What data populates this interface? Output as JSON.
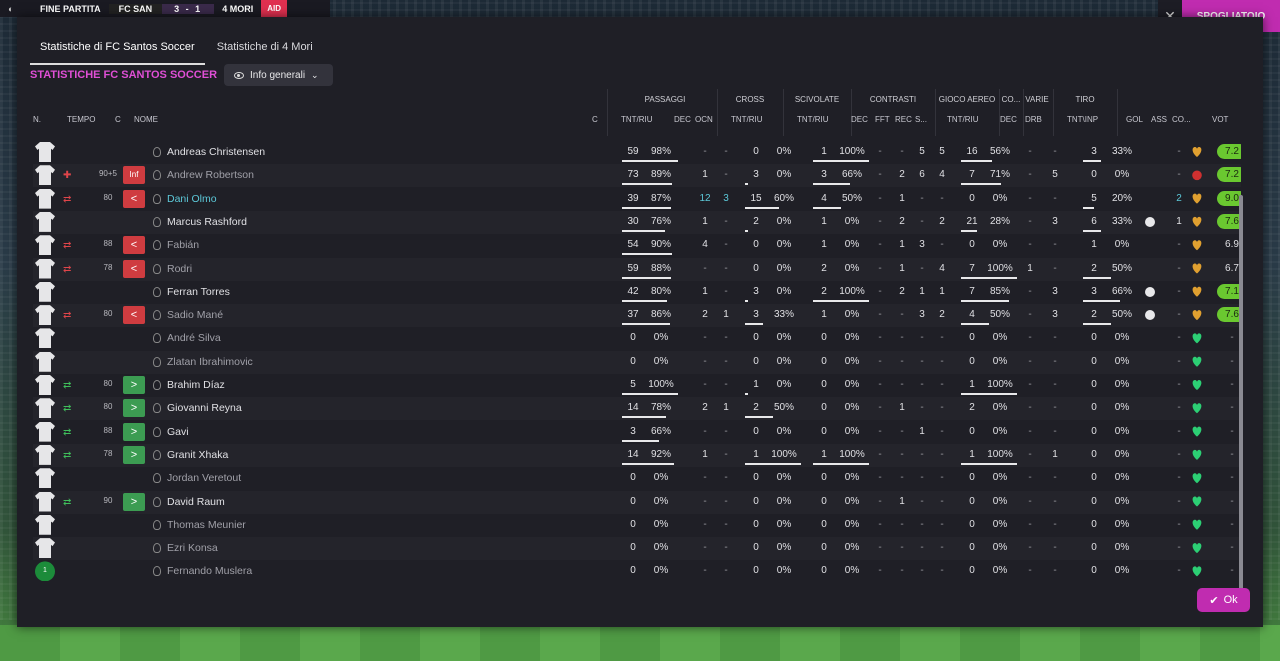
{
  "topbar": {
    "status": "FINE PARTITA",
    "team1": "FC SAN",
    "score": "3 - 1",
    "team2": "4 MORI",
    "tag": "AID"
  },
  "right_button": "SPOGLIATOIO",
  "close": "✕",
  "tabs": [
    "Statistiche di FC Santos Soccer",
    "Statistiche di 4 Mori"
  ],
  "heading": "STATISTICHE FC SANTOS SOCCER",
  "view_select": "Info generali",
  "group_headers": [
    "PASSAGGI",
    "CROSS",
    "SCIVOLATE",
    "CONTRASTI",
    "GIOCO AEREO",
    "CO...",
    "VARIE",
    "TIRO"
  ],
  "column_headers": [
    "N.",
    "TEMPO",
    "C",
    "NOME",
    "C",
    "TNT/RIU",
    "DEC",
    "OCN",
    "TNT/RIU",
    "TNT/RIU",
    "DEC",
    "FFT",
    "REC",
    "S...",
    "TNT/RIU",
    "DEC",
    "DRB",
    "TNT\\INP",
    "GOL",
    "ASS",
    "CO...",
    "VOT"
  ],
  "ok_label": "Ok",
  "colors": {
    "accent": "#c02cb0",
    "heading": "#e04fd6",
    "rating_good": "#6ac830",
    "sub_out": "#cf3c40",
    "sub_in": "#3c9c52"
  },
  "players": [
    {
      "name": "Andreas Christensen",
      "sub": "",
      "tempo": "",
      "badge": "",
      "pas": [
        "59",
        "98%"
      ],
      "pass_frac": 1,
      "pdec": "-",
      "pocn": "-",
      "cross": [
        "0",
        "0%"
      ],
      "sciv": [
        "1",
        "100%"
      ],
      "sciv_frac": 1,
      "cdec": "-",
      "cfft": "-",
      "crec": "5",
      "cs": "5",
      "aereo": [
        "16",
        "56%"
      ],
      "aereo_frac": 0.56,
      "codec": "-",
      "drb": "-",
      "tiro": [
        "3",
        "33%"
      ],
      "tiro_frac": 0.33,
      "gol": "",
      "ass": "-",
      "form": "gold",
      "vot": "7.2",
      "vot_style": "g",
      "name_style": ""
    },
    {
      "name": "Andrew Robertson",
      "sub": "inj",
      "tempo": "90+5",
      "badge": "Inf",
      "pas": [
        "73",
        "89%"
      ],
      "pass_frac": 0.89,
      "pdec": "1",
      "pocn": "-",
      "cross": [
        "3",
        "0%"
      ],
      "sciv": [
        "3",
        "66%"
      ],
      "sciv_frac": 0.66,
      "cdec": "-",
      "cfft": "2",
      "crec": "6",
      "cs": "4",
      "aereo": [
        "7",
        "71%"
      ],
      "aereo_frac": 0.71,
      "codec": "-",
      "drb": "5",
      "tiro": [
        "0",
        "0%"
      ],
      "tiro_frac": 0,
      "gol": "",
      "ass": "-",
      "form": "red",
      "vot": "7.2",
      "vot_style": "g",
      "name_style": "dim"
    },
    {
      "name": "Dani Olmo",
      "sub": "out",
      "tempo": "80",
      "badge": "<",
      "pas": [
        "39",
        "87%"
      ],
      "pass_frac": 0.87,
      "pdec": "12",
      "pocn": "3",
      "cross": [
        "15",
        "60%"
      ],
      "sciv": [
        "4",
        "50%"
      ],
      "sciv_frac": 0.5,
      "cdec": "-",
      "cfft": "1",
      "crec": "-",
      "cs": "-",
      "aereo": [
        "0",
        "0%"
      ],
      "aereo_frac": 0,
      "codec": "-",
      "drb": "-",
      "tiro": [
        "5",
        "20%"
      ],
      "tiro_frac": 0.2,
      "gol": "",
      "ass": "2",
      "form": "gold",
      "vot": "9.0",
      "vot_style": "g",
      "name_style": "hl"
    },
    {
      "name": "Marcus Rashford",
      "sub": "",
      "tempo": "",
      "badge": "",
      "pas": [
        "30",
        "76%"
      ],
      "pass_frac": 0.76,
      "pdec": "1",
      "pocn": "-",
      "cross": [
        "2",
        "0%"
      ],
      "sciv": [
        "1",
        "0%"
      ],
      "sciv_frac": 0,
      "cdec": "-",
      "cfft": "2",
      "crec": "-",
      "cs": "2",
      "aereo": [
        "21",
        "28%"
      ],
      "aereo_frac": 0.28,
      "codec": "-",
      "drb": "3",
      "tiro": [
        "6",
        "33%"
      ],
      "tiro_frac": 0.33,
      "gol": "ball",
      "ass": "1",
      "form": "gold",
      "vot": "7.6",
      "vot_style": "g",
      "name_style": ""
    },
    {
      "name": "Fabián",
      "sub": "out",
      "tempo": "88",
      "badge": "<",
      "pas": [
        "54",
        "90%"
      ],
      "pass_frac": 0.9,
      "pdec": "4",
      "pocn": "-",
      "cross": [
        "0",
        "0%"
      ],
      "sciv": [
        "1",
        "0%"
      ],
      "sciv_frac": 0,
      "cdec": "-",
      "cfft": "1",
      "crec": "3",
      "cs": "-",
      "aereo": [
        "0",
        "0%"
      ],
      "aereo_frac": 0,
      "codec": "-",
      "drb": "-",
      "tiro": [
        "1",
        "0%"
      ],
      "tiro_frac": 0,
      "gol": "",
      "ass": "-",
      "form": "gold",
      "vot": "6.9",
      "vot_style": "n",
      "name_style": "dim"
    },
    {
      "name": "Rodri",
      "sub": "out",
      "tempo": "78",
      "badge": "<",
      "pas": [
        "59",
        "88%"
      ],
      "pass_frac": 0.88,
      "pdec": "-",
      "pocn": "-",
      "cross": [
        "0",
        "0%"
      ],
      "sciv": [
        "2",
        "0%"
      ],
      "sciv_frac": 0,
      "cdec": "-",
      "cfft": "1",
      "crec": "-",
      "cs": "4",
      "aereo": [
        "7",
        "100%"
      ],
      "aereo_frac": 1,
      "codec": "1",
      "drb": "-",
      "tiro": [
        "2",
        "50%"
      ],
      "tiro_frac": 0.5,
      "gol": "",
      "ass": "-",
      "form": "gold",
      "vot": "6.7",
      "vot_style": "n",
      "name_style": "dim"
    },
    {
      "name": "Ferran Torres",
      "sub": "",
      "tempo": "",
      "badge": "",
      "pas": [
        "42",
        "80%"
      ],
      "pass_frac": 0.8,
      "pdec": "1",
      "pocn": "-",
      "cross": [
        "3",
        "0%"
      ],
      "sciv": [
        "2",
        "100%"
      ],
      "sciv_frac": 1,
      "cdec": "-",
      "cfft": "2",
      "crec": "1",
      "cs": "1",
      "aereo": [
        "7",
        "85%"
      ],
      "aereo_frac": 0.85,
      "codec": "-",
      "drb": "3",
      "tiro": [
        "3",
        "66%"
      ],
      "tiro_frac": 0.66,
      "gol": "ball",
      "ass": "-",
      "form": "gold",
      "vot": "7.1",
      "vot_style": "g",
      "name_style": ""
    },
    {
      "name": "Sadio Mané",
      "sub": "out",
      "tempo": "80",
      "badge": "<",
      "pas": [
        "37",
        "86%"
      ],
      "pass_frac": 0.86,
      "pdec": "2",
      "pocn": "1",
      "cross": [
        "3",
        "33%"
      ],
      "sciv": [
        "1",
        "0%"
      ],
      "sciv_frac": 0,
      "cdec": "-",
      "cfft": "-",
      "crec": "3",
      "cs": "2",
      "aereo": [
        "4",
        "50%"
      ],
      "aereo_frac": 0.5,
      "codec": "-",
      "drb": "3",
      "tiro": [
        "2",
        "50%"
      ],
      "tiro_frac": 0.5,
      "gol": "ball",
      "ass": "-",
      "form": "gold",
      "vot": "7.6",
      "vot_style": "g",
      "name_style": "dim"
    },
    {
      "name": "André Silva",
      "sub": "",
      "tempo": "",
      "badge": "",
      "pas": [
        "0",
        "0%"
      ],
      "pass_frac": 0,
      "pdec": "-",
      "pocn": "-",
      "cross": [
        "0",
        "0%"
      ],
      "sciv": [
        "0",
        "0%"
      ],
      "sciv_frac": 0,
      "cdec": "-",
      "cfft": "-",
      "crec": "-",
      "cs": "-",
      "aereo": [
        "0",
        "0%"
      ],
      "aereo_frac": 0,
      "codec": "-",
      "drb": "-",
      "tiro": [
        "0",
        "0%"
      ],
      "tiro_frac": 0,
      "gol": "",
      "ass": "-",
      "form": "green",
      "vot": "-",
      "vot_style": "dash",
      "name_style": "dim"
    },
    {
      "name": "Zlatan Ibrahimovic",
      "sub": "",
      "tempo": "",
      "badge": "",
      "pas": [
        "0",
        "0%"
      ],
      "pass_frac": 0,
      "pdec": "-",
      "pocn": "-",
      "cross": [
        "0",
        "0%"
      ],
      "sciv": [
        "0",
        "0%"
      ],
      "sciv_frac": 0,
      "cdec": "-",
      "cfft": "-",
      "crec": "-",
      "cs": "-",
      "aereo": [
        "0",
        "0%"
      ],
      "aereo_frac": 0,
      "codec": "-",
      "drb": "-",
      "tiro": [
        "0",
        "0%"
      ],
      "tiro_frac": 0,
      "gol": "",
      "ass": "-",
      "form": "green",
      "vot": "-",
      "vot_style": "dash",
      "name_style": "dim"
    },
    {
      "name": "Brahim Díaz",
      "sub": "in",
      "tempo": "80",
      "badge": ">",
      "pas": [
        "5",
        "100%"
      ],
      "pass_frac": 1,
      "pdec": "-",
      "pocn": "-",
      "cross": [
        "1",
        "0%"
      ],
      "sciv": [
        "0",
        "0%"
      ],
      "sciv_frac": 0,
      "cdec": "-",
      "cfft": "-",
      "crec": "-",
      "cs": "-",
      "aereo": [
        "1",
        "100%"
      ],
      "aereo_frac": 1,
      "codec": "-",
      "drb": "-",
      "tiro": [
        "0",
        "0%"
      ],
      "tiro_frac": 0,
      "gol": "",
      "ass": "-",
      "form": "green",
      "vot": "-",
      "vot_style": "dash",
      "name_style": ""
    },
    {
      "name": "Giovanni Reyna",
      "sub": "in",
      "tempo": "80",
      "badge": ">",
      "pas": [
        "14",
        "78%"
      ],
      "pass_frac": 0.78,
      "pdec": "2",
      "pocn": "1",
      "cross": [
        "2",
        "50%"
      ],
      "sciv": [
        "0",
        "0%"
      ],
      "sciv_frac": 0,
      "cdec": "-",
      "cfft": "1",
      "crec": "-",
      "cs": "-",
      "aereo": [
        "2",
        "0%"
      ],
      "aereo_frac": 0,
      "codec": "-",
      "drb": "-",
      "tiro": [
        "0",
        "0%"
      ],
      "tiro_frac": 0,
      "gol": "",
      "ass": "-",
      "form": "green",
      "vot": "-",
      "vot_style": "dash",
      "name_style": ""
    },
    {
      "name": "Gavi",
      "sub": "in",
      "tempo": "88",
      "badge": ">",
      "pas": [
        "3",
        "66%"
      ],
      "pass_frac": 0.66,
      "pdec": "-",
      "pocn": "-",
      "cross": [
        "0",
        "0%"
      ],
      "sciv": [
        "0",
        "0%"
      ],
      "sciv_frac": 0,
      "cdec": "-",
      "cfft": "-",
      "crec": "1",
      "cs": "-",
      "aereo": [
        "0",
        "0%"
      ],
      "aereo_frac": 0,
      "codec": "-",
      "drb": "-",
      "tiro": [
        "0",
        "0%"
      ],
      "tiro_frac": 0,
      "gol": "",
      "ass": "-",
      "form": "green",
      "vot": "-",
      "vot_style": "dash",
      "name_style": ""
    },
    {
      "name": "Granit Xhaka",
      "sub": "in",
      "tempo": "78",
      "badge": ">",
      "pas": [
        "14",
        "92%"
      ],
      "pass_frac": 0.92,
      "pdec": "1",
      "pocn": "-",
      "cross": [
        "1",
        "100%"
      ],
      "sciv": [
        "1",
        "100%"
      ],
      "sciv_frac": 1,
      "cdec": "-",
      "cfft": "-",
      "crec": "-",
      "cs": "-",
      "aereo": [
        "1",
        "100%"
      ],
      "aereo_frac": 1,
      "codec": "-",
      "drb": "1",
      "tiro": [
        "0",
        "0%"
      ],
      "tiro_frac": 0,
      "gol": "",
      "ass": "-",
      "form": "green",
      "vot": "-",
      "vot_style": "dash",
      "name_style": ""
    },
    {
      "name": "Jordan Veretout",
      "sub": "",
      "tempo": "",
      "badge": "",
      "pas": [
        "0",
        "0%"
      ],
      "pass_frac": 0,
      "pdec": "-",
      "pocn": "-",
      "cross": [
        "0",
        "0%"
      ],
      "sciv": [
        "0",
        "0%"
      ],
      "sciv_frac": 0,
      "cdec": "-",
      "cfft": "-",
      "crec": "-",
      "cs": "-",
      "aereo": [
        "0",
        "0%"
      ],
      "aereo_frac": 0,
      "codec": "-",
      "drb": "-",
      "tiro": [
        "0",
        "0%"
      ],
      "tiro_frac": 0,
      "gol": "",
      "ass": "-",
      "form": "green",
      "vot": "-",
      "vot_style": "dash",
      "name_style": "dim"
    },
    {
      "name": "David Raum",
      "sub": "in",
      "tempo": "90",
      "badge": ">",
      "pas": [
        "0",
        "0%"
      ],
      "pass_frac": 0,
      "pdec": "-",
      "pocn": "-",
      "cross": [
        "0",
        "0%"
      ],
      "sciv": [
        "0",
        "0%"
      ],
      "sciv_frac": 0,
      "cdec": "-",
      "cfft": "1",
      "crec": "-",
      "cs": "-",
      "aereo": [
        "0",
        "0%"
      ],
      "aereo_frac": 0,
      "codec": "-",
      "drb": "-",
      "tiro": [
        "0",
        "0%"
      ],
      "tiro_frac": 0,
      "gol": "",
      "ass": "-",
      "form": "green",
      "vot": "-",
      "vot_style": "dash",
      "name_style": ""
    },
    {
      "name": "Thomas Meunier",
      "sub": "",
      "tempo": "",
      "badge": "",
      "pas": [
        "0",
        "0%"
      ],
      "pass_frac": 0,
      "pdec": "-",
      "pocn": "-",
      "cross": [
        "0",
        "0%"
      ],
      "sciv": [
        "0",
        "0%"
      ],
      "sciv_frac": 0,
      "cdec": "-",
      "cfft": "-",
      "crec": "-",
      "cs": "-",
      "aereo": [
        "0",
        "0%"
      ],
      "aereo_frac": 0,
      "codec": "-",
      "drb": "-",
      "tiro": [
        "0",
        "0%"
      ],
      "tiro_frac": 0,
      "gol": "",
      "ass": "-",
      "form": "green",
      "vot": "-",
      "vot_style": "dash",
      "name_style": "dim"
    },
    {
      "name": "Ezri Konsa",
      "sub": "",
      "tempo": "",
      "badge": "",
      "pas": [
        "0",
        "0%"
      ],
      "pass_frac": 0,
      "pdec": "-",
      "pocn": "-",
      "cross": [
        "0",
        "0%"
      ],
      "sciv": [
        "0",
        "0%"
      ],
      "sciv_frac": 0,
      "cdec": "-",
      "cfft": "-",
      "crec": "-",
      "cs": "-",
      "aereo": [
        "0",
        "0%"
      ],
      "aereo_frac": 0,
      "codec": "-",
      "drb": "-",
      "tiro": [
        "0",
        "0%"
      ],
      "tiro_frac": 0,
      "gol": "",
      "ass": "-",
      "form": "green",
      "vot": "-",
      "vot_style": "dash",
      "name_style": "dim"
    },
    {
      "name": "Fernando Muslera",
      "sub": "",
      "tempo": "",
      "badge": "",
      "gk_number": "1",
      "pas": [
        "0",
        "0%"
      ],
      "pass_frac": 0,
      "pdec": "-",
      "pocn": "-",
      "cross": [
        "0",
        "0%"
      ],
      "sciv": [
        "0",
        "0%"
      ],
      "sciv_frac": 0,
      "cdec": "-",
      "cfft": "-",
      "crec": "-",
      "cs": "-",
      "aereo": [
        "0",
        "0%"
      ],
      "aereo_frac": 0,
      "codec": "-",
      "drb": "-",
      "tiro": [
        "0",
        "0%"
      ],
      "tiro_frac": 0,
      "gol": "",
      "ass": "-",
      "form": "green",
      "vot": "-",
      "vot_style": "dash",
      "name_style": "dim"
    }
  ]
}
